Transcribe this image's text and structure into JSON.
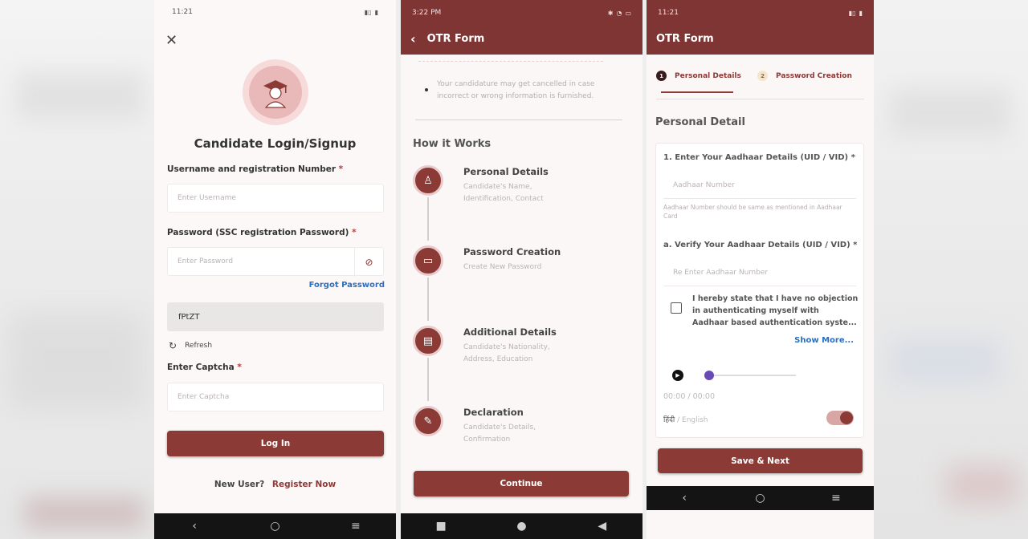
{
  "login": {
    "status_time": "11:21",
    "title": "Candidate Login/Signup",
    "username_label": "Username and registration Number",
    "username_placeholder": "Enter Username",
    "password_label": "Password (SSC registration Password)",
    "password_placeholder": "Enter Password",
    "forgot_password": "Forgot Password",
    "captcha_text": "fPtZT",
    "refresh_label": "Refresh",
    "captcha_label": "Enter Captcha",
    "captcha_placeholder": "Enter Captcha",
    "login_button": "Log In",
    "new_user": "New User?",
    "register_now": "Register Now",
    "required_mark": "*"
  },
  "otr_info": {
    "status_time": "3:22 PM",
    "header_title": "OTR Form",
    "note": "Your candidature may get cancelled in case incorrect or wrong information is furnished.",
    "how_it_works": "How it Works",
    "steps": [
      {
        "title": "Personal Details",
        "desc": "Candidate's Name, Identification, Contact",
        "icon": "user-icon"
      },
      {
        "title": "Password Creation",
        "desc": "Create New Password",
        "icon": "password-icon"
      },
      {
        "title": "Additional Details",
        "desc": "Candidate's Nationality, Address, Education",
        "icon": "document-icon"
      },
      {
        "title": "Declaration",
        "desc": "Candidate's Details, Confirmation",
        "icon": "declaration-icon"
      }
    ],
    "continue_button": "Continue"
  },
  "otr_form": {
    "status_time": "11:21",
    "header_title": "OTR Form",
    "tabs": [
      {
        "num": "1",
        "label": "Personal Details"
      },
      {
        "num": "2",
        "label": "Password Creation"
      }
    ],
    "section_title": "Personal Detail",
    "aadhaar_label": "1. Enter Your Aadhaar Details (UID / VID) *",
    "aadhaar_placeholder": "Aadhaar Number",
    "aadhaar_hint": "Aadhaar Number should be same as mentioned in Aadhaar Card",
    "verify_label": "a. Verify Your Aadhaar Details (UID / VID) *",
    "verify_placeholder": "Re Enter Aadhaar Number",
    "consent_line1": "I hereby state that I have no objection",
    "consent_line2": "in authenticating myself with",
    "consent_line3": "Aadhaar based authentication syste...",
    "show_more": "Show More...",
    "audio_time": "00:00 / 00:00",
    "lang_hindi": "हिंदी",
    "lang_english": "/ English",
    "save_button": "Save & Next"
  },
  "colors": {
    "brand": "#7f3533",
    "button": "#8b3a36",
    "link": "#2a6fc0"
  }
}
